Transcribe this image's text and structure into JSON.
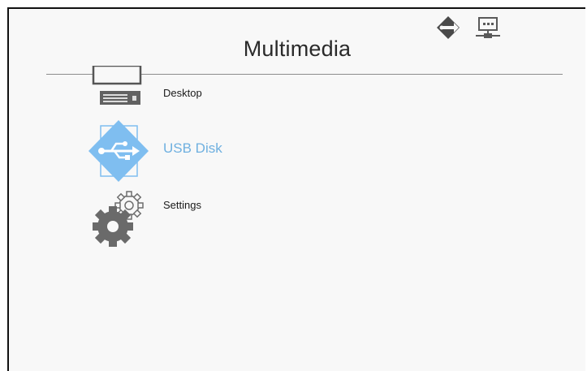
{
  "header": {
    "title": "Multimedia",
    "status_icons": [
      "usb-connection-icon",
      "network-icon"
    ]
  },
  "menu": {
    "items": [
      {
        "label": "Desktop",
        "icon": "desktop-computer-icon",
        "selected": false
      },
      {
        "label": "USB Disk",
        "icon": "usb-disk-icon",
        "selected": true
      },
      {
        "label": "Settings",
        "icon": "gears-icon",
        "selected": false
      }
    ]
  },
  "colors": {
    "selected_accent": "#6fb0e0",
    "selected_icon_fill": "#7fbef0",
    "icon_gray": "#707070",
    "background": "#f8f8f8"
  }
}
